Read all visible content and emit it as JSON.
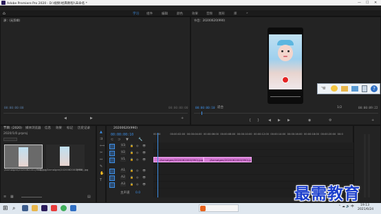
{
  "window": {
    "title": "Adobe Premiere Pro 2020 - D:\\视频\\经典教程\\\\未命名 *",
    "controls": [
      "—",
      "☐",
      "✕"
    ]
  },
  "menu": [
    "文件(F)",
    "编辑(E)",
    "剪辑(C)",
    "序列(S)",
    "标记(M)",
    "图形(G)",
    "视图(V)",
    "窗口(W)",
    "帮助(H)"
  ],
  "workspaces": [
    "学习",
    "组件",
    "编辑",
    "颜色",
    "效果",
    "音频",
    "图形",
    "库",
    "»"
  ],
  "active_workspace": "学习",
  "source_panel": {
    "title": "源：(无剪辑)",
    "timecode_left": "00:00:00:00",
    "timecode_right": "00:00:00:00"
  },
  "program_panel": {
    "title": "节目：20200620(990)",
    "timecode_left": "00:00:00:10",
    "fit": "适合",
    "timecode_right": "00:00:09:22",
    "ratio": "1/2"
  },
  "project_panel": {
    "tabs": [
      "节目: (2020)",
      "媒体浏览器",
      "信息",
      "效果",
      "标记",
      "历史记录"
    ],
    "path": "2020/1/0.prproj",
    "items": [
      {
        "name": "/Anmalgee/2020062000(990).jpg",
        "duration": "5:00"
      },
      {
        "name": "/Anmalgee/2020062000(990).jpg",
        "duration": "5:00"
      }
    ]
  },
  "timeline": {
    "tab": "20200620(990)",
    "timecode": "00:00:00:10",
    "ruler": [
      "00:00",
      "00:00:02:00",
      "00:00:04:00",
      "00:00:06:00",
      "00:00:08:00",
      "00:00:10:00",
      "00:00:12:00",
      "00:00:14:00",
      "00:00:16:00",
      "00:00:18:00",
      "00:00:20:00",
      "00:0"
    ],
    "tracks": [
      "V3",
      "V2",
      "V1",
      "A1",
      "A2",
      "A3"
    ],
    "master": "主声道",
    "master_value": "0.0",
    "clips": [
      {
        "label": "/Anmalgee/2020062000(990).jpg",
        "start": 0,
        "end": 5
      },
      {
        "label": "/Anmalgee/2020062000(990).jpg",
        "start": 5,
        "end": 9.8
      }
    ],
    "duration_total": 20
  },
  "taskbar": {
    "time": "19:13",
    "date": "2021/6/24",
    "tray": [
      "⌃",
      "☁",
      "🔊",
      "中"
    ]
  },
  "floating_toolbar": {
    "icons": [
      "hand-icon",
      "chat-icon",
      "folder-icon",
      "picture-icon",
      "document-icon",
      "help-icon"
    ]
  },
  "watermark": "最需教育",
  "colors": {
    "accent": "#3d8fe6",
    "clip": "#d57ad4",
    "playhead": "#3d8fe6",
    "taskbar": "#dfe7ef"
  }
}
